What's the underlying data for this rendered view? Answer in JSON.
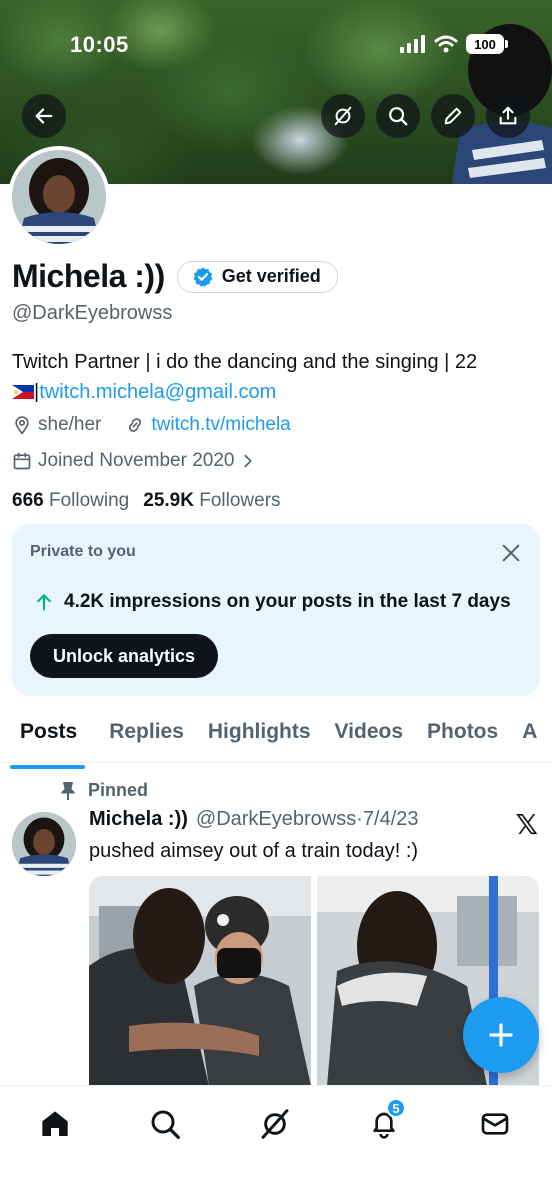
{
  "status_bar": {
    "time": "10:05",
    "battery": "100"
  },
  "header_icons": [
    "back-arrow-icon",
    "grok-icon",
    "search-icon",
    "edit-icon",
    "share-icon"
  ],
  "profile": {
    "name": "Michela :))",
    "verify_label": "Get verified",
    "handle": "@DarkEyebrowss",
    "bio_text": "Twitch Partner | i do the dancing and the singing | 22",
    "bio_email": "twitch.michela@gmail.com",
    "pronouns": "she/her",
    "website": "twitch.tv/michela",
    "joined": "Joined November 2020",
    "following_count": "666",
    "following_label": "Following",
    "followers_count": "25.9K",
    "followers_label": "Followers"
  },
  "analytics_card": {
    "label": "Private to you",
    "stat": "4.2K impressions on your posts in the last 7 days",
    "button": "Unlock analytics"
  },
  "tabs": [
    {
      "label": "Posts",
      "active": true
    },
    {
      "label": "Replies",
      "active": false
    },
    {
      "label": "Highlights",
      "active": false
    },
    {
      "label": "Videos",
      "active": false
    },
    {
      "label": "Photos",
      "active": false
    },
    {
      "label": "A",
      "active": false
    }
  ],
  "post": {
    "pinned_label": "Pinned",
    "author": "Michela :))",
    "handle": "@DarkEyebrowss",
    "separator": "·",
    "date": "7/4/23",
    "text": "pushed aimsey out of a train today! :)",
    "x_logo": "𝕏"
  },
  "compose_button": "+",
  "bottom_nav": {
    "items": [
      "home-icon",
      "search-icon",
      "grok-icon",
      "notifications-icon",
      "messages-icon"
    ],
    "notification_count": "5"
  },
  "colors": {
    "accent": "#1d9bf0",
    "text": "#0f1419",
    "muted": "#536471",
    "card_bg": "#e8f5fd"
  }
}
